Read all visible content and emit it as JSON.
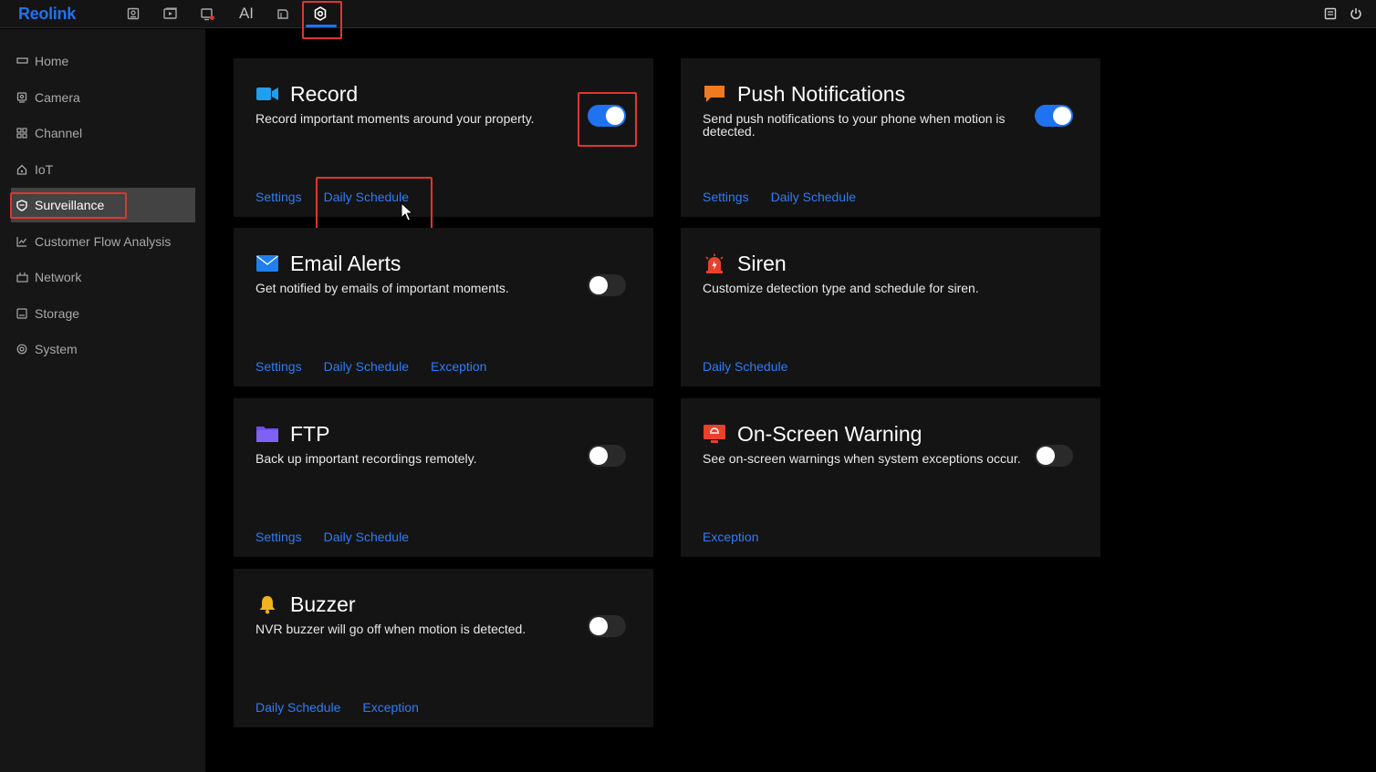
{
  "app": {
    "logo": "Reolink"
  },
  "topnav": {
    "ai_label": "AI"
  },
  "sidebar": {
    "items": [
      {
        "label": "Home",
        "icon": "home-icon"
      },
      {
        "label": "Camera",
        "icon": "camera-icon"
      },
      {
        "label": "Channel",
        "icon": "channel-icon"
      },
      {
        "label": "IoT",
        "icon": "iot-icon"
      },
      {
        "label": "Surveillance",
        "icon": "shield-icon",
        "active": true
      },
      {
        "label": "Customer Flow Analysis",
        "icon": "chart-icon"
      },
      {
        "label": "Network",
        "icon": "network-icon"
      },
      {
        "label": "Storage",
        "icon": "storage-icon"
      },
      {
        "label": "System",
        "icon": "system-icon"
      }
    ]
  },
  "cards": {
    "record": {
      "title": "Record",
      "desc": "Record important moments around your property.",
      "enabled": true,
      "links": [
        "Settings",
        "Daily Schedule"
      ]
    },
    "push": {
      "title": "Push Notifications",
      "desc": "Send push notifications to your phone when motion is detected.",
      "enabled": true,
      "links": [
        "Settings",
        "Daily Schedule"
      ]
    },
    "email": {
      "title": "Email Alerts",
      "desc": "Get notified by emails of important moments.",
      "enabled": false,
      "links": [
        "Settings",
        "Daily Schedule",
        "Exception"
      ]
    },
    "siren": {
      "title": "Siren",
      "desc": "Customize detection type and schedule for siren.",
      "links": [
        "Daily Schedule"
      ]
    },
    "ftp": {
      "title": "FTP",
      "desc": "Back up important recordings remotely.",
      "enabled": false,
      "links": [
        "Settings",
        "Daily Schedule"
      ]
    },
    "onscreen": {
      "title": "On-Screen Warning",
      "desc": "See on-screen warnings when system exceptions occur.",
      "enabled": false,
      "links": [
        "Exception"
      ]
    },
    "buzzer": {
      "title": "Buzzer",
      "desc": "NVR buzzer will go off when motion is detected.",
      "enabled": false,
      "links": [
        "Daily Schedule",
        "Exception"
      ]
    }
  },
  "colors": {
    "accent": "#1f73f0",
    "link": "#2e7cf6",
    "highlight": "#e0362c"
  }
}
